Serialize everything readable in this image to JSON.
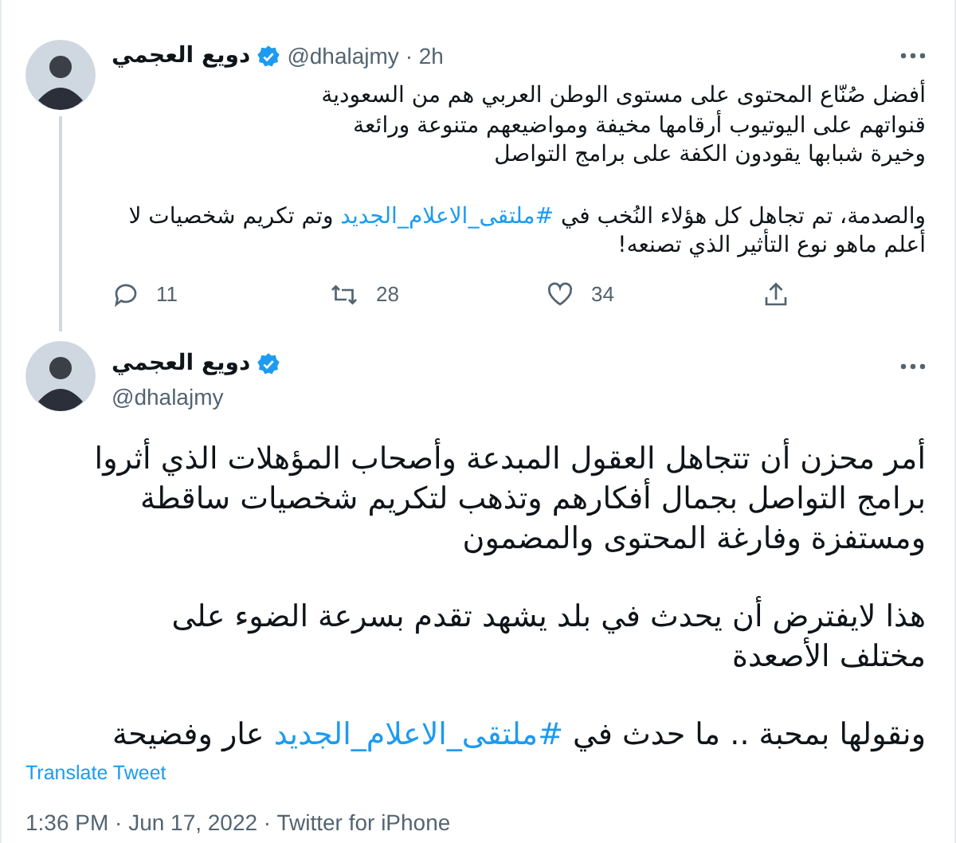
{
  "reply_tweet": {
    "author_name": "دويع العجمي",
    "verified": true,
    "handle_time": "@dhalajmy · 2h",
    "paragraphs": [
      {
        "lines": [
          [
            {
              "kind": "text",
              "text": "أفضل صُنّاع المحتوى على مستوى الوطن العربي هم من السعودية"
            }
          ],
          [
            {
              "kind": "text",
              "text": "قنواتهم على اليوتيوب أرقامها مخيفة ومواضيعهم متنوعة ورائعة"
            }
          ],
          [
            {
              "kind": "text",
              "text": "وخيرة شبابها يقودون الكفة على برامج التواصل"
            }
          ]
        ]
      },
      {
        "lines": [
          [
            {
              "kind": "text",
              "text": "والصدمة، تم تجاهل كل هؤلاء النُخب في "
            },
            {
              "kind": "hashtag",
              "text": "#ملتقى_الاعلام_الجديد"
            },
            {
              "kind": "text",
              "text": " وتم تكريم شخصيات لا"
            }
          ],
          [
            {
              "kind": "text",
              "text": "أعلم ماهو نوع التأثير الذي تصنعه!"
            }
          ]
        ]
      }
    ],
    "action_counts": {
      "reply": "11",
      "retweet": "28",
      "like": "34"
    }
  },
  "main_tweet": {
    "author_name": "دويع العجمي",
    "verified": true,
    "handle": "@dhalajmy",
    "paragraphs": [
      {
        "lines": [
          [
            {
              "kind": "text",
              "text": "أمر محزن أن تتجاهل العقول المبدعة وأصحاب المؤهلات الذي أثروا"
            }
          ],
          [
            {
              "kind": "text",
              "text": "برامج التواصل بجمال أفكارهم وتذهب لتكريم شخصيات ساقطة"
            }
          ],
          [
            {
              "kind": "text",
              "text": "ومستفزة وفارغة المحتوى والمضمون"
            }
          ]
        ]
      },
      {
        "lines": [
          [
            {
              "kind": "text",
              "text": "هذا لايفترض أن يحدث في بلد يشهد تقدم بسرعة الضوء على"
            }
          ],
          [
            {
              "kind": "text",
              "text": "مختلف الأصعدة"
            }
          ]
        ]
      },
      {
        "lines": [
          [
            {
              "kind": "text",
              "text": "ونقولها بمحبة .. ما حدث في "
            },
            {
              "kind": "hashtag",
              "text": "#ملتقى_الاعلام_الجديد"
            },
            {
              "kind": "text",
              "text": " عار وفضيحة"
            }
          ]
        ]
      }
    ],
    "translate": "Translate Tweet",
    "meta": "1:36 PM · Jun 17, 2022 · Twitter for iPhone"
  }
}
